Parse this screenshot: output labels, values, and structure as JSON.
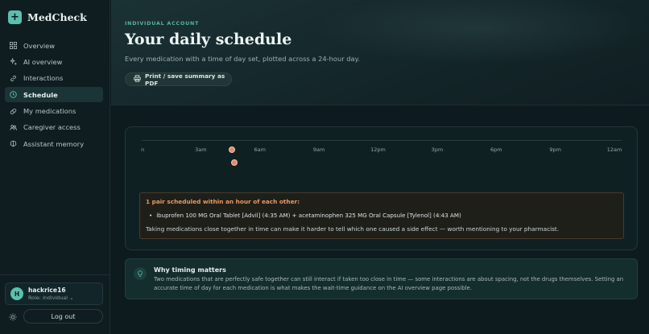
{
  "brand": {
    "name": "MedCheck",
    "logo_glyph": "+"
  },
  "sidebar": {
    "items": [
      {
        "label": "Overview",
        "icon": "grid-icon",
        "active": false
      },
      {
        "label": "AI overview",
        "icon": "sparkle-icon",
        "active": false
      },
      {
        "label": "Interactions",
        "icon": "link-icon",
        "active": false
      },
      {
        "label": "Schedule",
        "icon": "clock-icon",
        "active": true
      },
      {
        "label": "My medications",
        "icon": "pill-icon",
        "active": false
      },
      {
        "label": "Caregiver access",
        "icon": "users-icon",
        "active": false
      },
      {
        "label": "Assistant memory",
        "icon": "brain-icon",
        "active": false
      }
    ]
  },
  "user": {
    "initial": "H",
    "name": "hackrice16",
    "role": "Role: Individual ⌄"
  },
  "footer": {
    "logout_label": "Log out",
    "theme_icon": "sun-icon"
  },
  "header": {
    "eyebrow": "INDIVIDUAL ACCOUNT",
    "title": "Your daily schedule",
    "subtitle": "Every medication with a time of day set, plotted across a 24-hour day.",
    "print_label": "Print / save summary as PDF",
    "print_icon": "printer-icon"
  },
  "timeline": {
    "ticks": [
      "n",
      "3am",
      "6am",
      "9am",
      "12pm",
      "3pm",
      "6pm",
      "9pm",
      "12am"
    ],
    "doses": [
      {
        "medication": "ibuprofen 100 MG Oral Tablet [Advil]",
        "hour": 4.583
      },
      {
        "medication": "acetaminophen 325 MG Oral Capsule [Tylenol]",
        "hour": 4.717
      }
    ]
  },
  "warning": {
    "title": "1 pair scheduled within an hour of each other:",
    "pairs": [
      "ibuprofen 100 MG Oral Tablet [Advil] (4:35 AM) + acetaminophen 325 MG Oral Capsule [Tylenol] (4:43 AM)"
    ],
    "note": "Taking medications close together in time can make it harder to tell which one caused a side effect — worth mentioning to your pharmacist."
  },
  "info": {
    "icon": "lightbulb-icon",
    "title": "Why timing matters",
    "body": "Two medications that are perfectly safe together can still interact if taken too close in time — some interactions are about spacing, not the drugs themselves. Setting an accurate time of day for each medication is what makes the wait-time guidance on the AI overview page possible."
  },
  "colors": {
    "accent": "#5bbfae",
    "warning": "#e79a62",
    "dose": "#e38a6b"
  }
}
